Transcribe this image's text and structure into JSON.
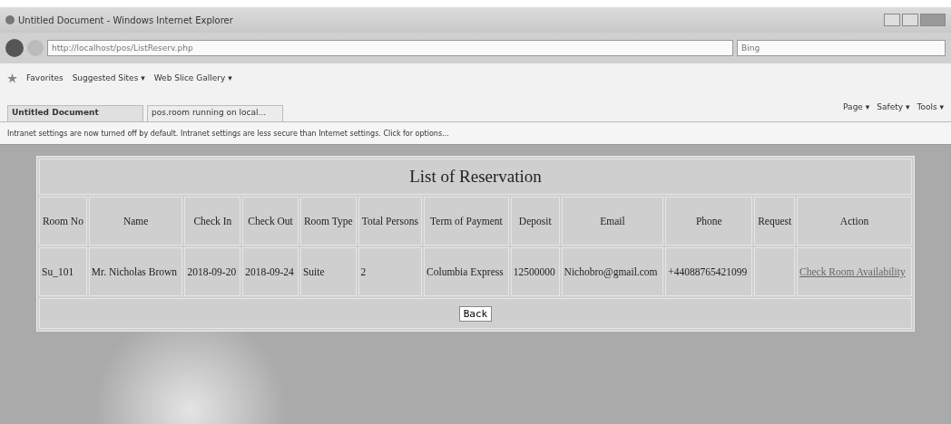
{
  "window": {
    "title": "Untitled Document - Windows Internet Explorer"
  },
  "address_bar": {
    "value": "http://localhost/pos/ListReserv.php"
  },
  "search": {
    "placeholder": "Bing"
  },
  "favorites_bar": {
    "label": "Favorites",
    "items": [
      "Suggested Sites ▾",
      "Web Slice Gallery ▾"
    ]
  },
  "tabs": [
    {
      "label": "Untitled Document",
      "selected": true
    },
    {
      "label": "pos.room running on local...",
      "selected": false
    }
  ],
  "command_bar": [
    "Page ▾",
    "Safety ▾",
    "Tools ▾"
  ],
  "info_bar": {
    "text": "Intranet settings are now turned off by default. Intranet settings are less secure than Internet settings. Click for options..."
  },
  "table": {
    "title": "List of Reservation",
    "columns": [
      "Room No",
      "Name",
      "Check In",
      "Check Out",
      "Room Type",
      "Total Persons",
      "Term of Payment",
      "Deposit",
      "Email",
      "Phone",
      "Request",
      "Action"
    ],
    "rows": [
      {
        "cells": [
          "Su_101",
          "Mr. Nicholas Brown",
          "2018-09-20",
          "2018-09-24",
          "Suite",
          "2",
          "Columbia Express",
          "12500000",
          "Nichobro@gmail.com",
          "+44088765421099",
          ""
        ],
        "action_link": "Check Room Availability"
      }
    ]
  },
  "back_button": "Back"
}
